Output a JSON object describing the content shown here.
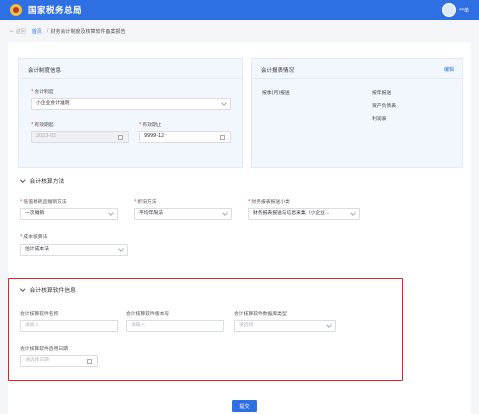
{
  "header": {
    "brand": "国家税务总局",
    "user_name": "**单"
  },
  "breadcrumb": {
    "back": "← 返回",
    "home": "首页",
    "sep": "/",
    "current": "财务会计制度及核算软件备案报告"
  },
  "system_card": {
    "title": "会计制度信息",
    "system_label": "会计制度",
    "system_value": "小企业会计准则",
    "start_label": "有效期起",
    "start_value": "2023-02",
    "end_label": "有效期止",
    "end_value": "9999-12"
  },
  "report_card": {
    "title": "会计报表情况",
    "edit": "编辑",
    "period_label": "按季(月)报送",
    "items": [
      "按年报送",
      "资产负债表",
      "利润表"
    ]
  },
  "accounting_method": {
    "title": "会计核算方法",
    "low_value_label": "低值易耗品摊销方法",
    "low_value_value": "一次摊销",
    "depr_label": "折旧方法",
    "depr_value": "平均年限法",
    "report_cat_label": "财务报表报送小类",
    "report_cat_value": "财务报表报送与信息采集（小企业...",
    "cost_label": "成本核算法",
    "cost_value": "估计成本法"
  },
  "software": {
    "title": "会计核算软件信息",
    "name_label": "会计核算软件名称",
    "name_placeholder": "请输入",
    "version_label": "会计核算软件版本号",
    "version_placeholder": "请输入",
    "db_label": "会计核算软件数据库类型",
    "db_placeholder": "请选择",
    "date_label": "会计核算软件启用日期",
    "date_placeholder": "请选择日期"
  },
  "submit_label": "提交"
}
